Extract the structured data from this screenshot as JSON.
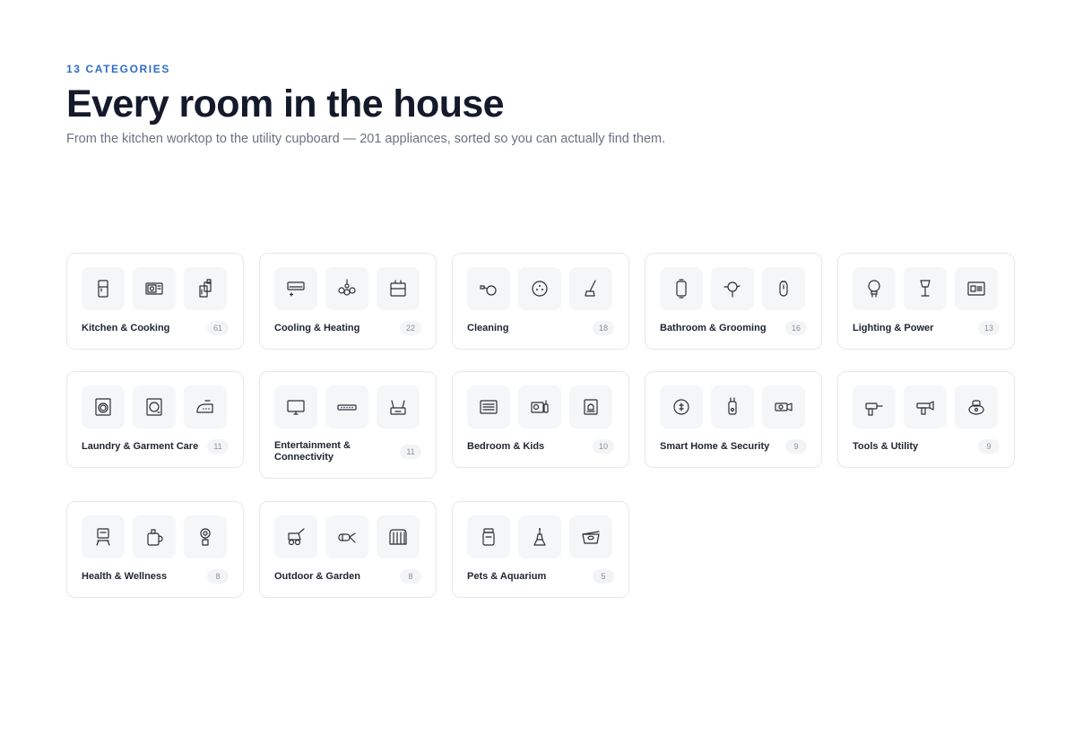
{
  "header": {
    "eyebrow": "13 CATEGORIES",
    "title": "Every room in the house",
    "subtitle": "From the kitchen worktop to the utility cupboard — 201 appliances, sorted so you can actually find them."
  },
  "categories": [
    {
      "label": "Kitchen & Cooking",
      "count": "61",
      "icons": [
        "refrigerator-icon",
        "microwave-icon",
        "blender-icon"
      ]
    },
    {
      "label": "Cooling & Heating",
      "count": "22",
      "icons": [
        "air-conditioner-icon",
        "ceiling-fan-icon",
        "heater-icon"
      ]
    },
    {
      "label": "Cleaning",
      "count": "18",
      "icons": [
        "vacuum-icon",
        "robot-vacuum-icon",
        "mop-icon"
      ]
    },
    {
      "label": "Bathroom & Grooming",
      "count": "16",
      "icons": [
        "mirror-icon",
        "hair-dryer-icon",
        "shaver-icon"
      ]
    },
    {
      "label": "Lighting & Power",
      "count": "13",
      "icons": [
        "light-bulb-icon",
        "table-lamp-icon",
        "power-panel-icon"
      ]
    },
    {
      "label": "Laundry & Garment Care",
      "count": "11",
      "icons": [
        "washing-machine-icon",
        "dryer-icon",
        "iron-icon"
      ]
    },
    {
      "label": "Entertainment & Connectivity",
      "count": "11",
      "icons": [
        "tv-icon",
        "soundbar-icon",
        "router-icon"
      ]
    },
    {
      "label": "Bedroom & Kids",
      "count": "10",
      "icons": [
        "electric-blanket-icon",
        "baby-monitor-icon",
        "night-light-icon"
      ]
    },
    {
      "label": "Smart Home & Security",
      "count": "9",
      "icons": [
        "thermostat-icon",
        "smart-plug-icon",
        "security-camera-icon"
      ]
    },
    {
      "label": "Tools & Utility",
      "count": "9",
      "icons": [
        "drill-icon",
        "heat-gun-icon",
        "sander-icon"
      ]
    },
    {
      "label": "Health & Wellness",
      "count": "8",
      "icons": [
        "massage-chair-icon",
        "humidifier-icon",
        "water-flosser-icon"
      ]
    },
    {
      "label": "Outdoor & Garden",
      "count": "8",
      "icons": [
        "lawn-mower-icon",
        "leaf-blower-icon",
        "patio-heater-icon"
      ]
    },
    {
      "label": "Pets & Aquarium",
      "count": "5",
      "icons": [
        "pet-feeder-icon",
        "pet-fountain-icon",
        "aquarium-icon"
      ]
    }
  ]
}
